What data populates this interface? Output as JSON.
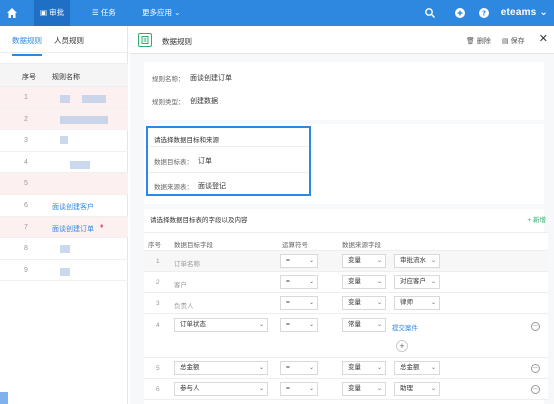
{
  "topbar": {
    "nav": [
      {
        "label": "审批",
        "active": true
      },
      {
        "label": "任务",
        "active": false
      },
      {
        "label": "更多应用",
        "active": false
      }
    ],
    "brand": "eteams"
  },
  "left": {
    "tabs": [
      "数据规则",
      "人员规则"
    ],
    "columns": [
      "序号",
      "规则名称"
    ],
    "rows": [
      {
        "no": "1",
        "name": ""
      },
      {
        "no": "2",
        "name": ""
      },
      {
        "no": "3",
        "name": ""
      },
      {
        "no": "4",
        "name": ""
      },
      {
        "no": "5",
        "name": ""
      },
      {
        "no": "6",
        "name": "面谈创建客户"
      },
      {
        "no": "7",
        "name": "面谈创建订单"
      },
      {
        "no": "8",
        "name": ""
      },
      {
        "no": "9",
        "name": ""
      }
    ]
  },
  "right": {
    "title": "数据规则",
    "delete_label": "删除",
    "save_label": "保存",
    "rule_name_label": "规则名称：",
    "rule_name_value": "面谈创建订单",
    "rule_type_label": "规则类型：",
    "rule_type_value": "创建数据",
    "pick_title": "请选择数据目标和来源",
    "target_label": "数据目标表：",
    "target_value": "订单",
    "source_label": "数据来源表：",
    "source_value": "面谈登记",
    "fields_title": "请选择数据目标表的字段以及内容",
    "add_new": "+ 新增",
    "columns": [
      "序号",
      "数据目标字段",
      "运算符号",
      "数据来源字段"
    ],
    "rows": [
      {
        "no": "1",
        "target": "订单名称",
        "op": "=",
        "type": "变量",
        "src": "审批流水"
      },
      {
        "no": "2",
        "target": "客户",
        "op": "=",
        "type": "变量",
        "src": "对应客户"
      },
      {
        "no": "3",
        "target": "负责人",
        "op": "=",
        "type": "变量",
        "src": "律师"
      },
      {
        "no": "4",
        "target": "订单状态",
        "op": "=",
        "type": "常量",
        "src": "提交案件"
      },
      {
        "no": "5",
        "target": "总金额",
        "op": "=",
        "type": "变量",
        "src": "总金额"
      },
      {
        "no": "6",
        "target": "参与人",
        "op": "=",
        "type": "变量",
        "src": "助理"
      }
    ]
  }
}
